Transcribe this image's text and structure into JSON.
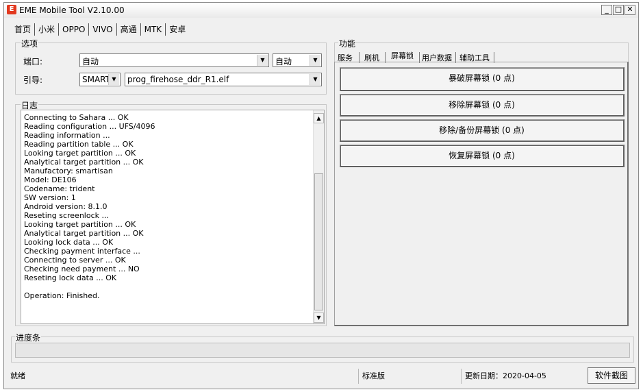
{
  "window": {
    "title": "EME Mobile Tool V2.10.00",
    "icon_letter": "E",
    "minimize_glyph": "_",
    "maximize_glyph": "□",
    "close_glyph": "✕"
  },
  "main_tabs": [
    {
      "label": "首页"
    },
    {
      "label": "小米"
    },
    {
      "label": "OPPO"
    },
    {
      "label": "VIVO"
    },
    {
      "label": "高通"
    },
    {
      "label": "MTK"
    },
    {
      "label": "安卓"
    }
  ],
  "options": {
    "group_label": "选项",
    "port_label": "端口:",
    "port_value": "自动",
    "port_mode_value": "自动",
    "boot_label": "引导:",
    "boot_type_value": "SMARTI",
    "boot_file_value": "prog_firehose_ddr_R1.elf"
  },
  "log": {
    "group_label": "日志",
    "lines": [
      "Connecting to Sahara ... OK",
      "Reading configuration ... UFS/4096",
      "Reading information ...",
      "Reading partition table ... OK",
      "Looking target partition ... OK",
      "Analytical target partition ... OK",
      "Manufactory: smartisan",
      "Model: DE106",
      "Codename: trident",
      "SW version: 1",
      "Android version: 8.1.0",
      "Reseting screenlock ...",
      "Looking target partition ... OK",
      "Analytical target partition ... OK",
      "Looking lock data ... OK",
      "Checking payment interface ...",
      "Connecting to server ... OK",
      "Checking need payment ... NO",
      "Reseting lock data ... OK",
      "",
      "Operation: Finished."
    ]
  },
  "functions": {
    "group_label": "功能",
    "tabs": [
      {
        "label": "服务"
      },
      {
        "label": "刷机"
      },
      {
        "label": "屏幕锁"
      },
      {
        "label": "用户数据"
      },
      {
        "label": "辅助工具"
      }
    ],
    "buttons": [
      {
        "label": "暴破屏幕锁 (0 点)"
      },
      {
        "label": "移除屏幕锁 (0 点)"
      },
      {
        "label": "移除/备份屏幕锁 (0 点)"
      },
      {
        "label": "恢复屏幕锁 (0 点)"
      }
    ]
  },
  "progress": {
    "group_label": "进度条",
    "value": 0
  },
  "status": {
    "state": "就绪",
    "edition": "标准版",
    "update_date": "更新日期：2020-04-05",
    "screenshot_button": "软件截图"
  },
  "colors": {
    "window_bg": "#f0f0f0",
    "icon_red": "#e2381e"
  }
}
